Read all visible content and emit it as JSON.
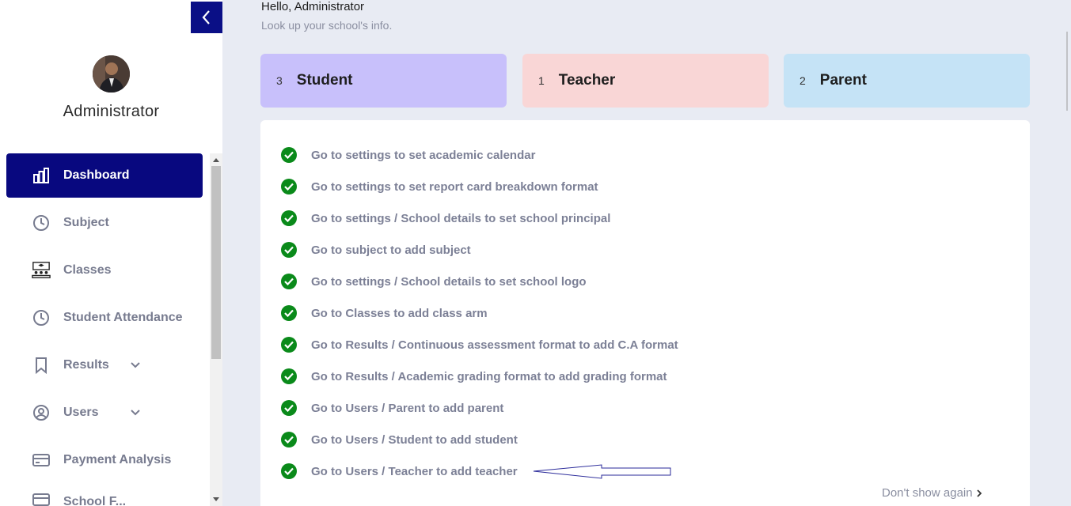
{
  "sidebar": {
    "user_name": "Administrator",
    "items": [
      {
        "label": "Dashboard",
        "icon": "bar-chart-icon"
      },
      {
        "label": "Subject",
        "icon": "clock-icon"
      },
      {
        "label": "Classes",
        "icon": "classroom-icon"
      },
      {
        "label": "Student Attendance",
        "icon": "clock-icon"
      },
      {
        "label": "Results",
        "icon": "bookmark-icon"
      },
      {
        "label": "Users",
        "icon": "user-circle-icon"
      },
      {
        "label": "Payment Analysis",
        "icon": "credit-card-icon"
      },
      {
        "label": "School F...",
        "icon": "credit-card-icon"
      }
    ]
  },
  "header": {
    "greeting": "Hello, Administrator",
    "subtitle": "Look up your school's info."
  },
  "stats": [
    {
      "count": "3",
      "label": "Student",
      "color": "#c8c0fb"
    },
    {
      "count": "1",
      "label": "Teacher",
      "color": "#f9d6d6"
    },
    {
      "count": "2",
      "label": "Parent",
      "color": "#c5e3f6"
    }
  ],
  "tasks": [
    "Go to settings to set academic calendar",
    "Go to settings to set report card breakdown format",
    "Go to settings / School details to set school principal",
    "Go to subject to add subject",
    "Go to settings / School details to set school logo",
    "Go to Classes to add class arm",
    "Go to Results / Continuous assessment format to add C.A format",
    "Go to Results / Academic grading format to add grading format",
    "Go to Users / Parent to add parent",
    "Go to Users / Student to add student",
    "Go to Users / Teacher to add teacher"
  ],
  "dont_show_label": "Don't show again",
  "colors": {
    "accent": "#0a0f86",
    "check": "#0a8a1a"
  }
}
